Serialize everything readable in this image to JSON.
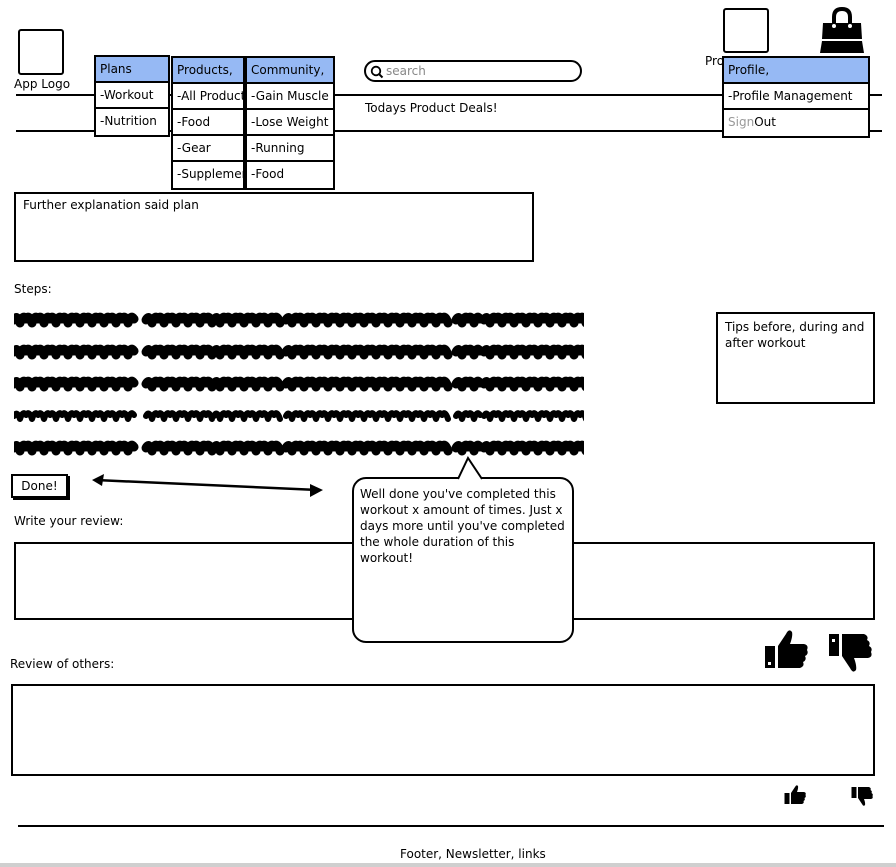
{
  "header": {
    "logo_label": "App Logo",
    "profile_label_partial": "Pro",
    "search_placeholder": "search",
    "deals_text": "Todays Product Deals!"
  },
  "menus": {
    "plans": {
      "head": "Plans",
      "items": [
        "-Workout",
        "-Nutrition"
      ]
    },
    "products": {
      "head": "Products,",
      "items": [
        "-All Products",
        "-Food",
        "-Gear",
        "-Supplements"
      ]
    },
    "community": {
      "head": "Community,",
      "items": [
        "-Gain Muscle",
        "-Lose Weight",
        "-Running",
        "-Food"
      ]
    },
    "profile": {
      "head": "Profile,",
      "item_management": "-Profile Management",
      "signout_prefix": "Sign",
      "signout_suffix": "Out"
    }
  },
  "plan_description": "Further explanation said plan",
  "steps_label": "Steps:",
  "tips_text": "Tips before, during and after workout",
  "done_button": "Done!",
  "bubble_text": "Well done you've completed this workout x amount of times. Just x days more until you've completed the whole duration of this workout!",
  "review_label": "Write your review:",
  "others_label": "Review of others:",
  "footer_text": "Footer, Newsletter, links",
  "icons": {
    "logo": "image-placeholder-icon",
    "profile": "image-placeholder-icon",
    "cart": "shopping-bag-icon",
    "search": "search-icon",
    "like": "thumbs-up-icon",
    "dislike": "thumbs-down-icon",
    "arrow": "double-arrow-icon"
  },
  "colors": {
    "menu_header": "#96b9f4"
  }
}
